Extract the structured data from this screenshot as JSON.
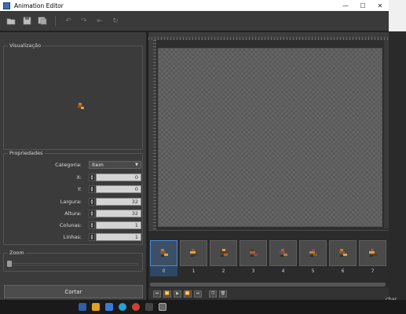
{
  "window": {
    "title": "Animation Editor",
    "minimize": "—",
    "maximize": "☐",
    "close": "✕"
  },
  "toolbar": {
    "icons": [
      "open-icon",
      "save-icon",
      "save-as-icon",
      "undo-icon",
      "redo-icon",
      "flip-icon",
      "refresh-icon"
    ]
  },
  "visualization": {
    "label": "Visualização"
  },
  "properties": {
    "label": "Propriedades",
    "category_label": "Categoria:",
    "category_value": "Item",
    "x_label": "X:",
    "x_value": "0",
    "y_label": "Y:",
    "y_value": "0",
    "width_label": "Largura:",
    "width_value": "32",
    "height_label": "Altura:",
    "height_value": "32",
    "columns_label": "Colunas:",
    "columns_value": "1",
    "rows_label": "Linhas:",
    "rows_value": "1"
  },
  "zoom": {
    "label": "Zoom",
    "level": 0
  },
  "cut_button": "Cortar",
  "frames": [
    "0",
    "1",
    "2",
    "3",
    "4",
    "5",
    "6",
    "7"
  ],
  "selected_frame": 0,
  "behind_window": {
    "text": "char"
  },
  "colors": {
    "accent": "#4a8bd6",
    "panel": "#3b3b3b",
    "canvas": "#5a5a5a"
  }
}
